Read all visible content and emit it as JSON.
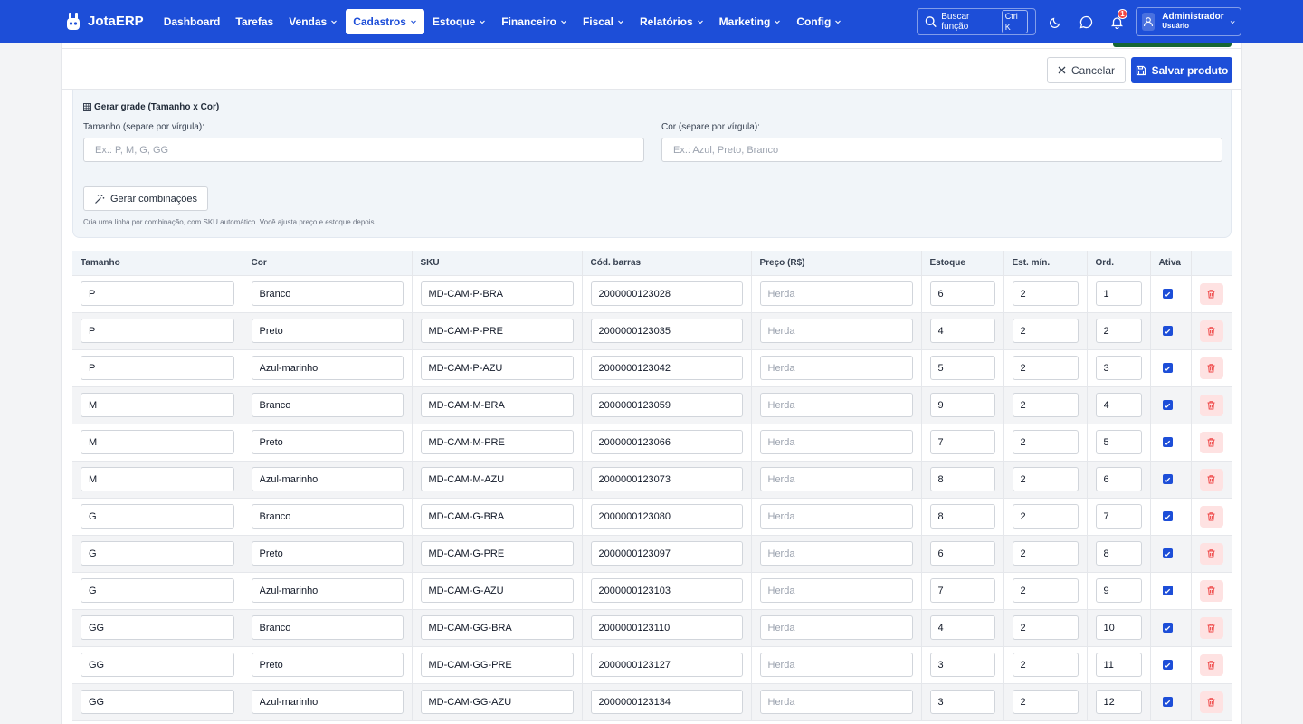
{
  "app": {
    "brand": "JotaERP"
  },
  "nav": {
    "items": [
      {
        "label": "Dashboard",
        "dropdown": false,
        "active": false
      },
      {
        "label": "Tarefas",
        "dropdown": false,
        "active": false
      },
      {
        "label": "Vendas",
        "dropdown": true,
        "active": false
      },
      {
        "label": "Cadastros",
        "dropdown": true,
        "active": true
      },
      {
        "label": "Estoque",
        "dropdown": true,
        "active": false
      },
      {
        "label": "Financeiro",
        "dropdown": true,
        "active": false
      },
      {
        "label": "Fiscal",
        "dropdown": true,
        "active": false
      },
      {
        "label": "Relatórios",
        "dropdown": true,
        "active": false
      },
      {
        "label": "Marketing",
        "dropdown": true,
        "active": false
      },
      {
        "label": "Config",
        "dropdown": true,
        "active": false
      }
    ]
  },
  "topbar": {
    "search_label": "Buscar função",
    "search_shortcut": "Ctrl K",
    "notification_count": "1",
    "user_name": "Administrador",
    "user_role": "Usuário",
    "icons": [
      "search-icon",
      "moon-icon",
      "chat-icon",
      "bell-icon",
      "user-icon",
      "chevron-down-icon"
    ]
  },
  "actions": {
    "cancel_label": "Cancelar",
    "save_label": "Salvar produto"
  },
  "grade": {
    "title": "Gerar grade (Tamanho x Cor)",
    "size_label": "Tamanho (separe por vírgula):",
    "size_placeholder": "Ex.: P, M, G, GG",
    "color_label": "Cor (separe por vírgula):",
    "color_placeholder": "Ex.: Azul, Preto, Branco",
    "generate_label": "Gerar combinações",
    "hint": "Cria uma linha por combinação, com SKU automático. Você ajusta preço e estoque depois."
  },
  "table": {
    "columns": [
      "Tamanho",
      "Cor",
      "SKU",
      "Cód. barras",
      "Preço (R$)",
      "Estoque",
      "Est. mín.",
      "Ord.",
      "Ativa",
      ""
    ],
    "price_placeholder": "Herda",
    "rows": [
      {
        "tamanho": "P",
        "cor": "Branco",
        "sku": "MD-CAM-P-BRA",
        "barras": "2000000123028",
        "preco": "",
        "estoque": "6",
        "est_min": "2",
        "ord": "1",
        "ativa": true
      },
      {
        "tamanho": "P",
        "cor": "Preto",
        "sku": "MD-CAM-P-PRE",
        "barras": "2000000123035",
        "preco": "",
        "estoque": "4",
        "est_min": "2",
        "ord": "2",
        "ativa": true
      },
      {
        "tamanho": "P",
        "cor": "Azul-marinho",
        "sku": "MD-CAM-P-AZU",
        "barras": "2000000123042",
        "preco": "",
        "estoque": "5",
        "est_min": "2",
        "ord": "3",
        "ativa": true
      },
      {
        "tamanho": "M",
        "cor": "Branco",
        "sku": "MD-CAM-M-BRA",
        "barras": "2000000123059",
        "preco": "",
        "estoque": "9",
        "est_min": "2",
        "ord": "4",
        "ativa": true
      },
      {
        "tamanho": "M",
        "cor": "Preto",
        "sku": "MD-CAM-M-PRE",
        "barras": "2000000123066",
        "preco": "",
        "estoque": "7",
        "est_min": "2",
        "ord": "5",
        "ativa": true
      },
      {
        "tamanho": "M",
        "cor": "Azul-marinho",
        "sku": "MD-CAM-M-AZU",
        "barras": "2000000123073",
        "preco": "",
        "estoque": "8",
        "est_min": "2",
        "ord": "6",
        "ativa": true
      },
      {
        "tamanho": "G",
        "cor": "Branco",
        "sku": "MD-CAM-G-BRA",
        "barras": "2000000123080",
        "preco": "",
        "estoque": "8",
        "est_min": "2",
        "ord": "7",
        "ativa": true
      },
      {
        "tamanho": "G",
        "cor": "Preto",
        "sku": "MD-CAM-G-PRE",
        "barras": "2000000123097",
        "preco": "",
        "estoque": "6",
        "est_min": "2",
        "ord": "8",
        "ativa": true
      },
      {
        "tamanho": "G",
        "cor": "Azul-marinho",
        "sku": "MD-CAM-G-AZU",
        "barras": "2000000123103",
        "preco": "",
        "estoque": "7",
        "est_min": "2",
        "ord": "9",
        "ativa": true
      },
      {
        "tamanho": "GG",
        "cor": "Branco",
        "sku": "MD-CAM-GG-BRA",
        "barras": "2000000123110",
        "preco": "",
        "estoque": "4",
        "est_min": "2",
        "ord": "10",
        "ativa": true
      },
      {
        "tamanho": "GG",
        "cor": "Preto",
        "sku": "MD-CAM-GG-PRE",
        "barras": "2000000123127",
        "preco": "",
        "estoque": "3",
        "est_min": "2",
        "ord": "11",
        "ativa": true
      },
      {
        "tamanho": "GG",
        "cor": "Azul-marinho",
        "sku": "MD-CAM-GG-AZU",
        "barras": "2000000123134",
        "preco": "",
        "estoque": "3",
        "est_min": "2",
        "ord": "12",
        "ativa": true
      }
    ]
  },
  "colors": {
    "primary": "#1d4ed8",
    "save_strip": "#166534",
    "delete_bg": "#fee2e2",
    "delete_icon": "#ef4444"
  }
}
